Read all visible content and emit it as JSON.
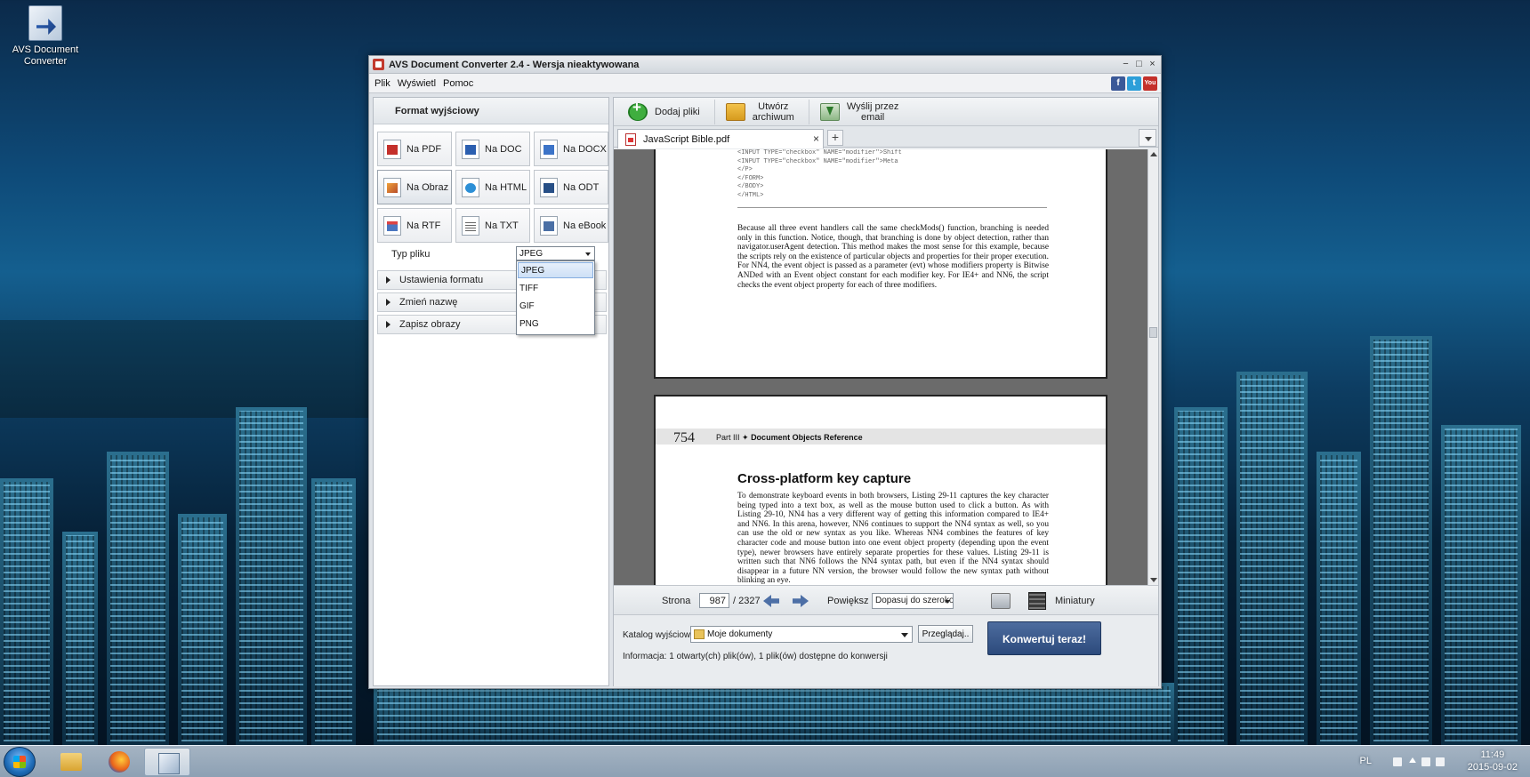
{
  "desktop": {
    "icons": [
      {
        "label_line1": "AVS Document",
        "label_line2": "Converter"
      }
    ]
  },
  "window": {
    "title": "AVS Document Converter 2.4 - Wersja nieaktywowana",
    "controls": {
      "minimize": "−",
      "maximize": "□",
      "close": "×"
    },
    "menu": [
      "Plik",
      "Wyświetl",
      "Pomoc"
    ],
    "social": [
      {
        "name": "facebook-icon",
        "glyph": "f",
        "color": "#3b5998"
      },
      {
        "name": "twitter-icon",
        "glyph": "t",
        "color": "#2d9fd9"
      },
      {
        "name": "youtube-icon",
        "glyph": "You",
        "color": "#c4302b"
      }
    ]
  },
  "left_panel": {
    "header": "Format wyjściowy",
    "formats": [
      {
        "label": "Na PDF",
        "icon": "pdf"
      },
      {
        "label": "Na DOC",
        "icon": "doc"
      },
      {
        "label": "Na DOCX",
        "icon": "docx"
      },
      {
        "label": "Na Obraz",
        "icon": "img",
        "active": true
      },
      {
        "label": "Na HTML",
        "icon": "html"
      },
      {
        "label": "Na ODT",
        "icon": "odt"
      },
      {
        "label": "Na RTF",
        "icon": "rtf"
      },
      {
        "label": "Na TXT",
        "icon": "txt"
      },
      {
        "label": "Na eBook",
        "icon": "ebook"
      }
    ],
    "file_type_label": "Typ pliku",
    "file_type_value": "JPEG",
    "file_type_options": [
      "JPEG",
      "TIFF",
      "GIF",
      "PNG"
    ],
    "sections": [
      "Ustawienia formatu",
      "Zmień nazwę",
      "Zapisz obrazy"
    ]
  },
  "toolbar": {
    "add_files": "Dodaj pliki",
    "create_archive_line1": "Utwórz",
    "create_archive_line2": "archiwum",
    "send_email_line1": "Wyślij przez",
    "send_email_line2": "email"
  },
  "tab": {
    "name": "JavaScript Bible.pdf",
    "close": "×",
    "add": "+"
  },
  "document": {
    "page1_code": "<INPUT TYPE=\"checkbox\" NAME=\"modifier\">Shift\n<INPUT TYPE=\"checkbox\" NAME=\"modifier\">Meta\n</P>\n</FORM>\n</BODY>\n</HTML>",
    "page1_paragraph": "Because all three event handlers call the same checkMods() function, branching is needed only in this function. Notice, though, that branching is done by object detection, rather than navigator.userAgent detection. This method makes the most sense for this example, because the scripts rely on the existence of particular objects and properties for their proper execution. For NN4, the event object is passed as a parameter (evt) whose modifiers property is Bitwise ANDed with an Event object constant for each modifier key. For IE4+ and NN6, the script checks the event object property for each of three modifiers.",
    "page2_number": "754",
    "page2_running_part": "Part III",
    "page2_running_title": "Document Objects Reference",
    "page2_heading": "Cross-platform key capture",
    "page2_paragraph": "To demonstrate keyboard events in both browsers, Listing 29-11 captures the key character being typed into a text box, as well as the mouse button used to click a button. As with Listing 29-10, NN4 has a very different way of getting this information compared to IE4+ and NN6. In this arena, however, NN6 continues to support the NN4 syntax as well, so you can use the old or new syntax as you like. Whereas NN4 combines the features of key character code and mouse button into one event object property (depending upon the event type), newer browsers have entirely separate properties for these values. Listing 29-11 is written such that NN6 follows the NN4 syntax path, but even if the NN4 syntax should disappear in a future NN version, the browser would follow the new syntax path without blinking an eye."
  },
  "navigation": {
    "page_label": "Strona",
    "page_current": "987",
    "page_total": "/ 2327",
    "zoom_label": "Powiększ",
    "zoom_value": "Dopasuj do szeroko",
    "thumbnails": "Miniatury"
  },
  "output": {
    "folder_label": "Katalog wyjściowy:",
    "folder_value": "Moje dokumenty",
    "browse": "Przeglądaj..",
    "info": "Informacja: 1 otwarty(ch) plik(ów), 1 plik(ów) dostępne do konwersji",
    "convert": "Konwertuj teraz!"
  },
  "taskbar": {
    "language": "PL",
    "time": "11:49",
    "date": "2015-09-02"
  }
}
